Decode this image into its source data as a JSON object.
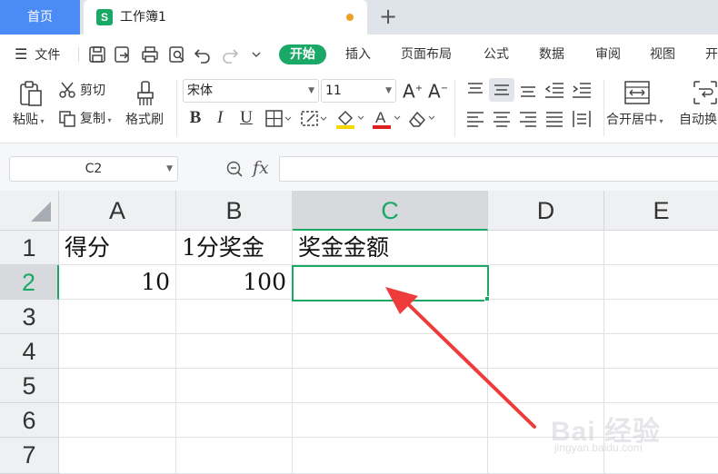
{
  "tabs": {
    "home_label": "首页",
    "doc_icon_letter": "S",
    "doc_title": "工作簿1",
    "new_tab_symbol": "+"
  },
  "menu": {
    "file_label": "文件",
    "items": [
      "开始",
      "插入",
      "页面布局",
      "公式",
      "数据",
      "审阅",
      "视图",
      "开"
    ]
  },
  "ribbon": {
    "paste_label": "粘贴",
    "cut_label": "剪切",
    "copy_label": "复制",
    "format_painter_label": "格式刷",
    "font_name": "宋体",
    "font_size": "11",
    "merge_center_label": "合开居中",
    "auto_wrap_label": "自动换"
  },
  "formula_bar": {
    "name_box": "C2",
    "fx_label": "fx",
    "formula_value": ""
  },
  "sheet": {
    "columns": [
      "A",
      "B",
      "C",
      "D",
      "E"
    ],
    "selected_column": "C",
    "rows": [
      "1",
      "2",
      "3",
      "4",
      "5",
      "6",
      "7"
    ],
    "selected_row": "2",
    "cells": {
      "A1": "得分",
      "B1": "1分奖金",
      "C1": "奖金金额",
      "A2": "10",
      "B2": "100",
      "C2": ""
    }
  },
  "watermark": {
    "logo_text": "Bai 经验",
    "sub_text": "jingyan.baidu.com"
  },
  "colors": {
    "accent_green": "#1aa867",
    "tab_blue": "#4b8bf5",
    "arrow_red": "#ee3b3b",
    "header_gray": "#eef0f2"
  }
}
